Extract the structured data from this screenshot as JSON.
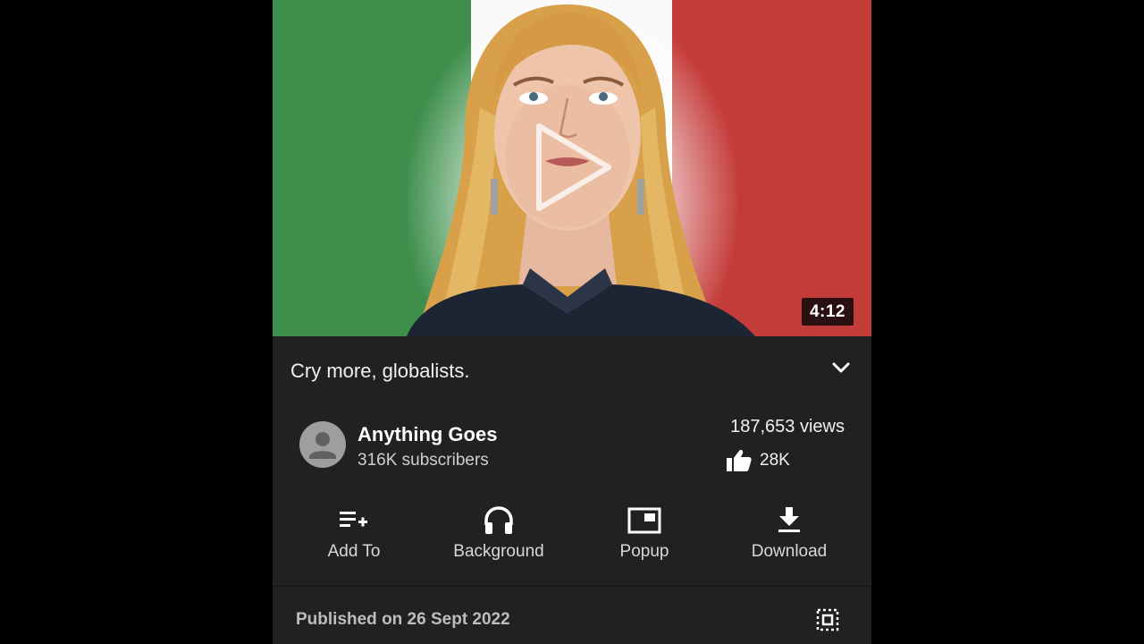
{
  "video": {
    "duration": "4:12",
    "title": "Cry more, globalists."
  },
  "channel": {
    "name": "Anything Goes",
    "subscribers": "316K subscribers"
  },
  "stats": {
    "views": "187,653 views",
    "likes": "28K"
  },
  "actions": [
    {
      "label": "Add To",
      "icon": "playlist-add-icon"
    },
    {
      "label": "Background",
      "icon": "headphones-icon"
    },
    {
      "label": "Popup",
      "icon": "picture-in-picture-icon"
    },
    {
      "label": "Download",
      "icon": "download-icon"
    }
  ],
  "published": "Published on 26 Sept 2022",
  "colors": {
    "background": "#212121",
    "flag_green": "#3e8f4c",
    "flag_white": "#fafafa",
    "flag_red": "#c43c3a"
  }
}
